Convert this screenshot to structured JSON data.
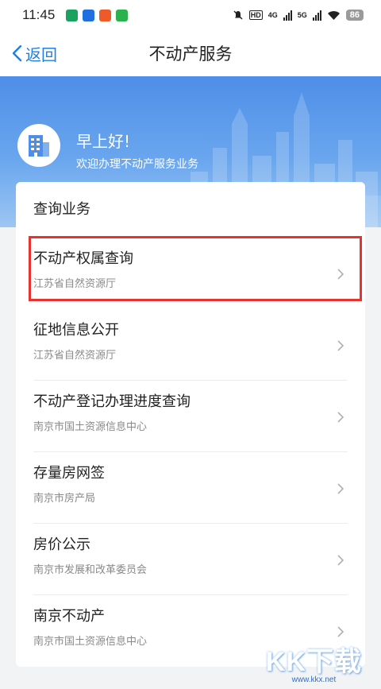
{
  "status_bar": {
    "time": "11:45",
    "hd": "HD",
    "net1": "4G",
    "net2": "5G",
    "battery": "86",
    "app_icons": [
      "#1aa260",
      "#1f6fe0",
      "#f0592a",
      "#2bb24c"
    ]
  },
  "nav": {
    "back_label": "返回",
    "title": "不动产服务"
  },
  "banner": {
    "greeting": "早上好!",
    "subtitle": "欢迎办理不动产服务业务"
  },
  "card": {
    "section_title": "查询业务",
    "items": [
      {
        "title": "不动产权属查询",
        "subtitle": "江苏省自然资源厅",
        "highlighted": true
      },
      {
        "title": "征地信息公开",
        "subtitle": "江苏省自然资源厅"
      },
      {
        "title": "不动产登记办理进度查询",
        "subtitle": "南京市国土资源信息中心"
      },
      {
        "title": "存量房网签",
        "subtitle": "南京市房产局"
      },
      {
        "title": "房价公示",
        "subtitle": "南京市发展和改革委员会"
      },
      {
        "title": "南京不动产",
        "subtitle": "南京市国土资源信息中心"
      }
    ]
  },
  "watermark": {
    "text": "KK下载",
    "url": "www.kkx.net"
  },
  "colors": {
    "accent": "#1f7fe6",
    "highlight": "#e8322f",
    "banner_top": "#4e8ee8"
  }
}
